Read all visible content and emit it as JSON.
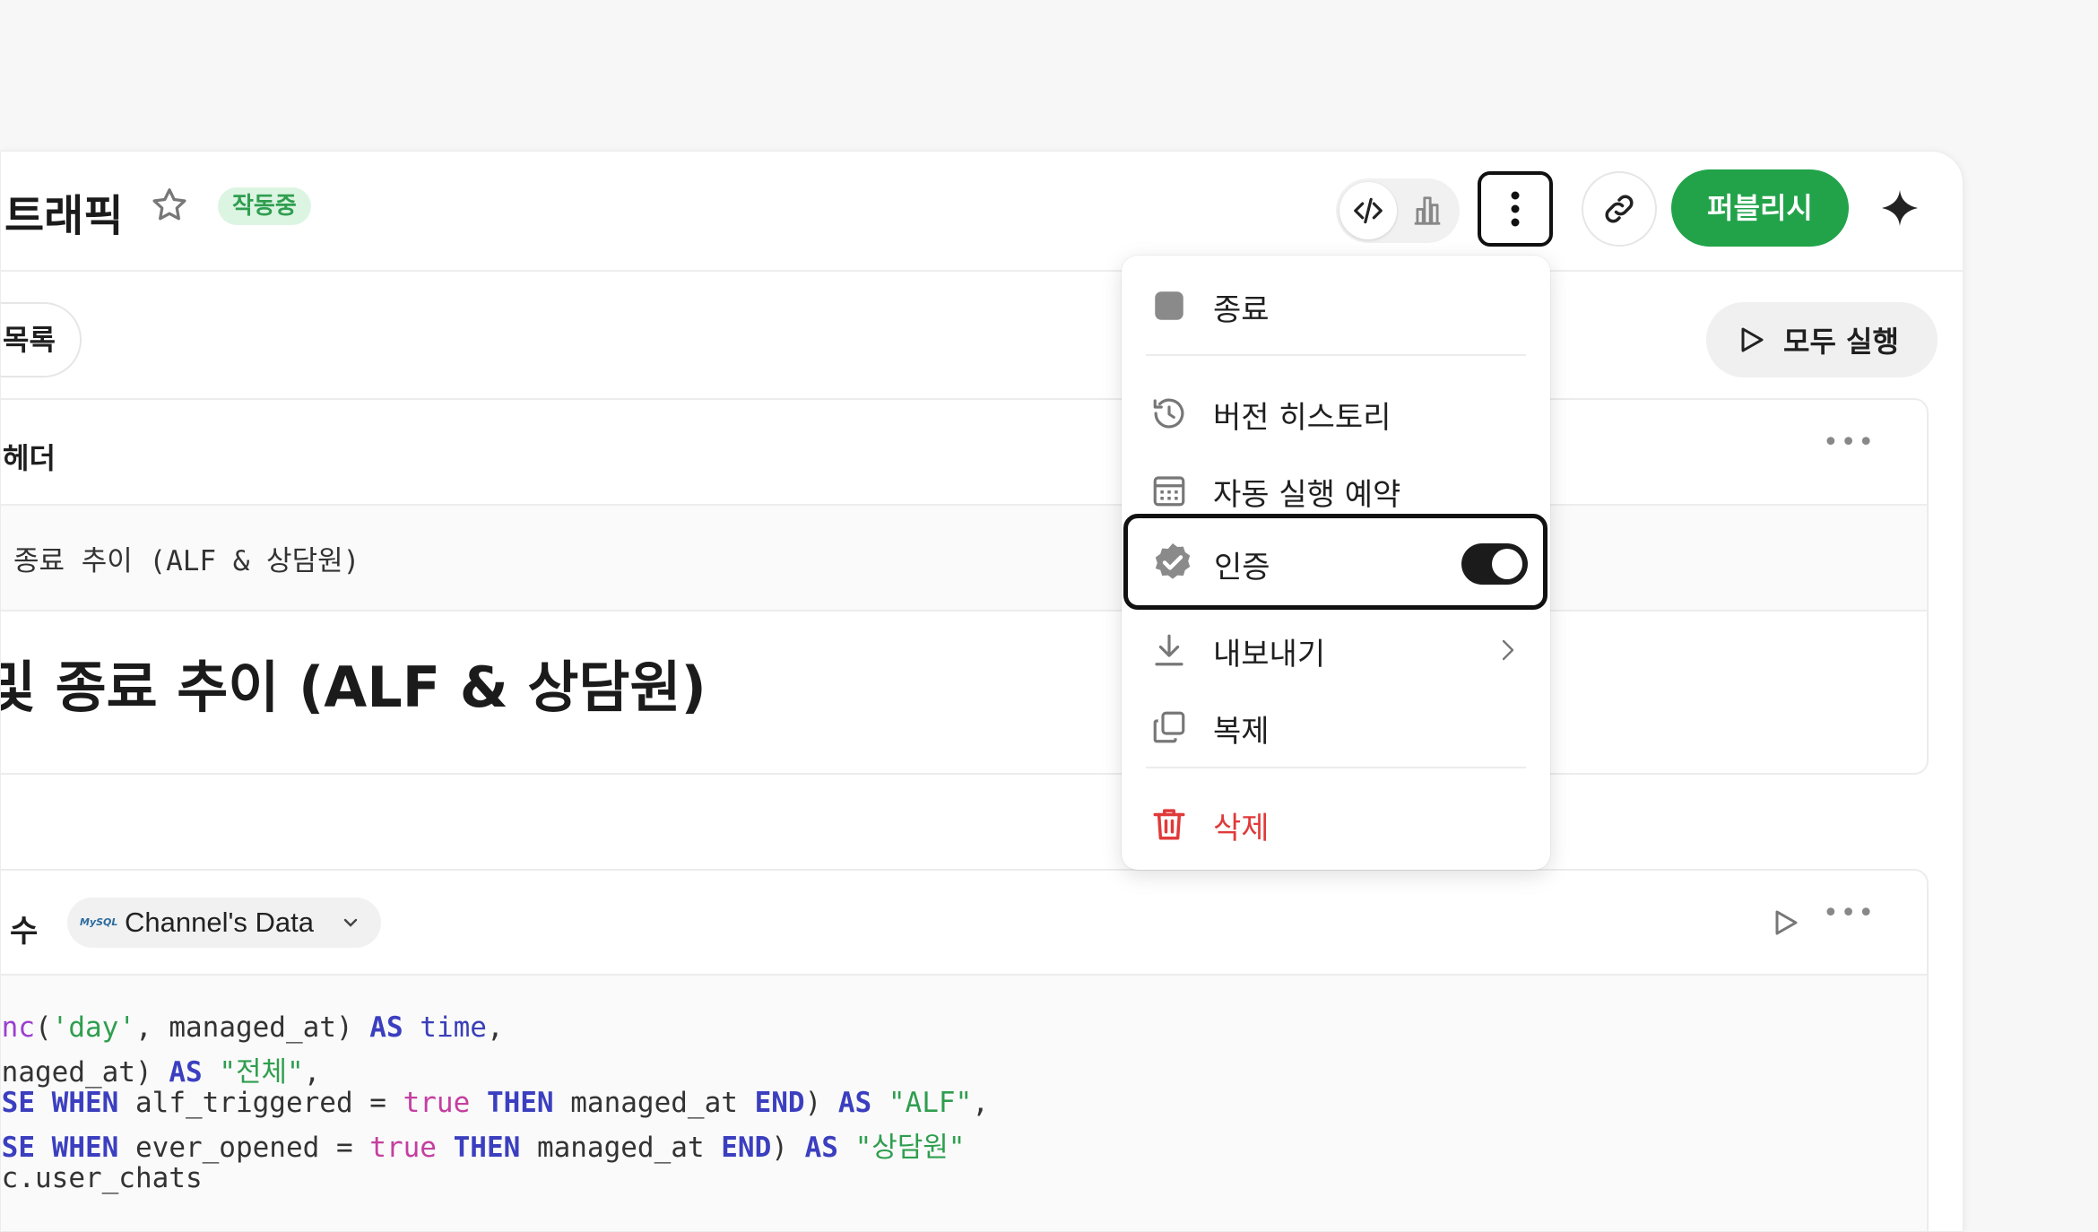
{
  "header": {
    "title": "트래픽",
    "status_badge": "작동중",
    "publish_label": "퍼블리시"
  },
  "toolbar": {
    "list_label": "목록",
    "run_all_label": "모두 실행"
  },
  "cells": [
    {
      "header": "헤더",
      "source_text": "종료 추이 (ALF & 상담원)",
      "heading": "및 종료 추이 (ALF & 상담원)"
    },
    {
      "label": "수",
      "datasource": "Channel's Data",
      "datasource_logo": "MySQL",
      "code_lines": [
        "unc('day', managed_at) AS time,",
        "anaged_at) AS \"전체\",",
        "ASE WHEN alf_triggered = true THEN managed_at END) AS \"ALF\",",
        "ASE WHEN ever_opened = true THEN managed_at END) AS \"상담원\"",
        " c.user_chats"
      ]
    }
  ],
  "menu": {
    "items": [
      {
        "label": "종료",
        "icon": "stop-icon"
      },
      {
        "label": "버전 히스토리",
        "icon": "history-icon"
      },
      {
        "label": "자동 실행 예약",
        "icon": "calendar-icon"
      },
      {
        "label": "인증",
        "icon": "verified-icon",
        "toggle_on": true
      },
      {
        "label": "내보내기",
        "icon": "download-icon"
      },
      {
        "label": "복제",
        "icon": "duplicate-icon"
      },
      {
        "label": "삭제",
        "icon": "trash-icon"
      }
    ]
  },
  "colors": {
    "accent": "#22a34a",
    "badge_bg": "#dcf5e2",
    "danger": "#e03a3a"
  }
}
